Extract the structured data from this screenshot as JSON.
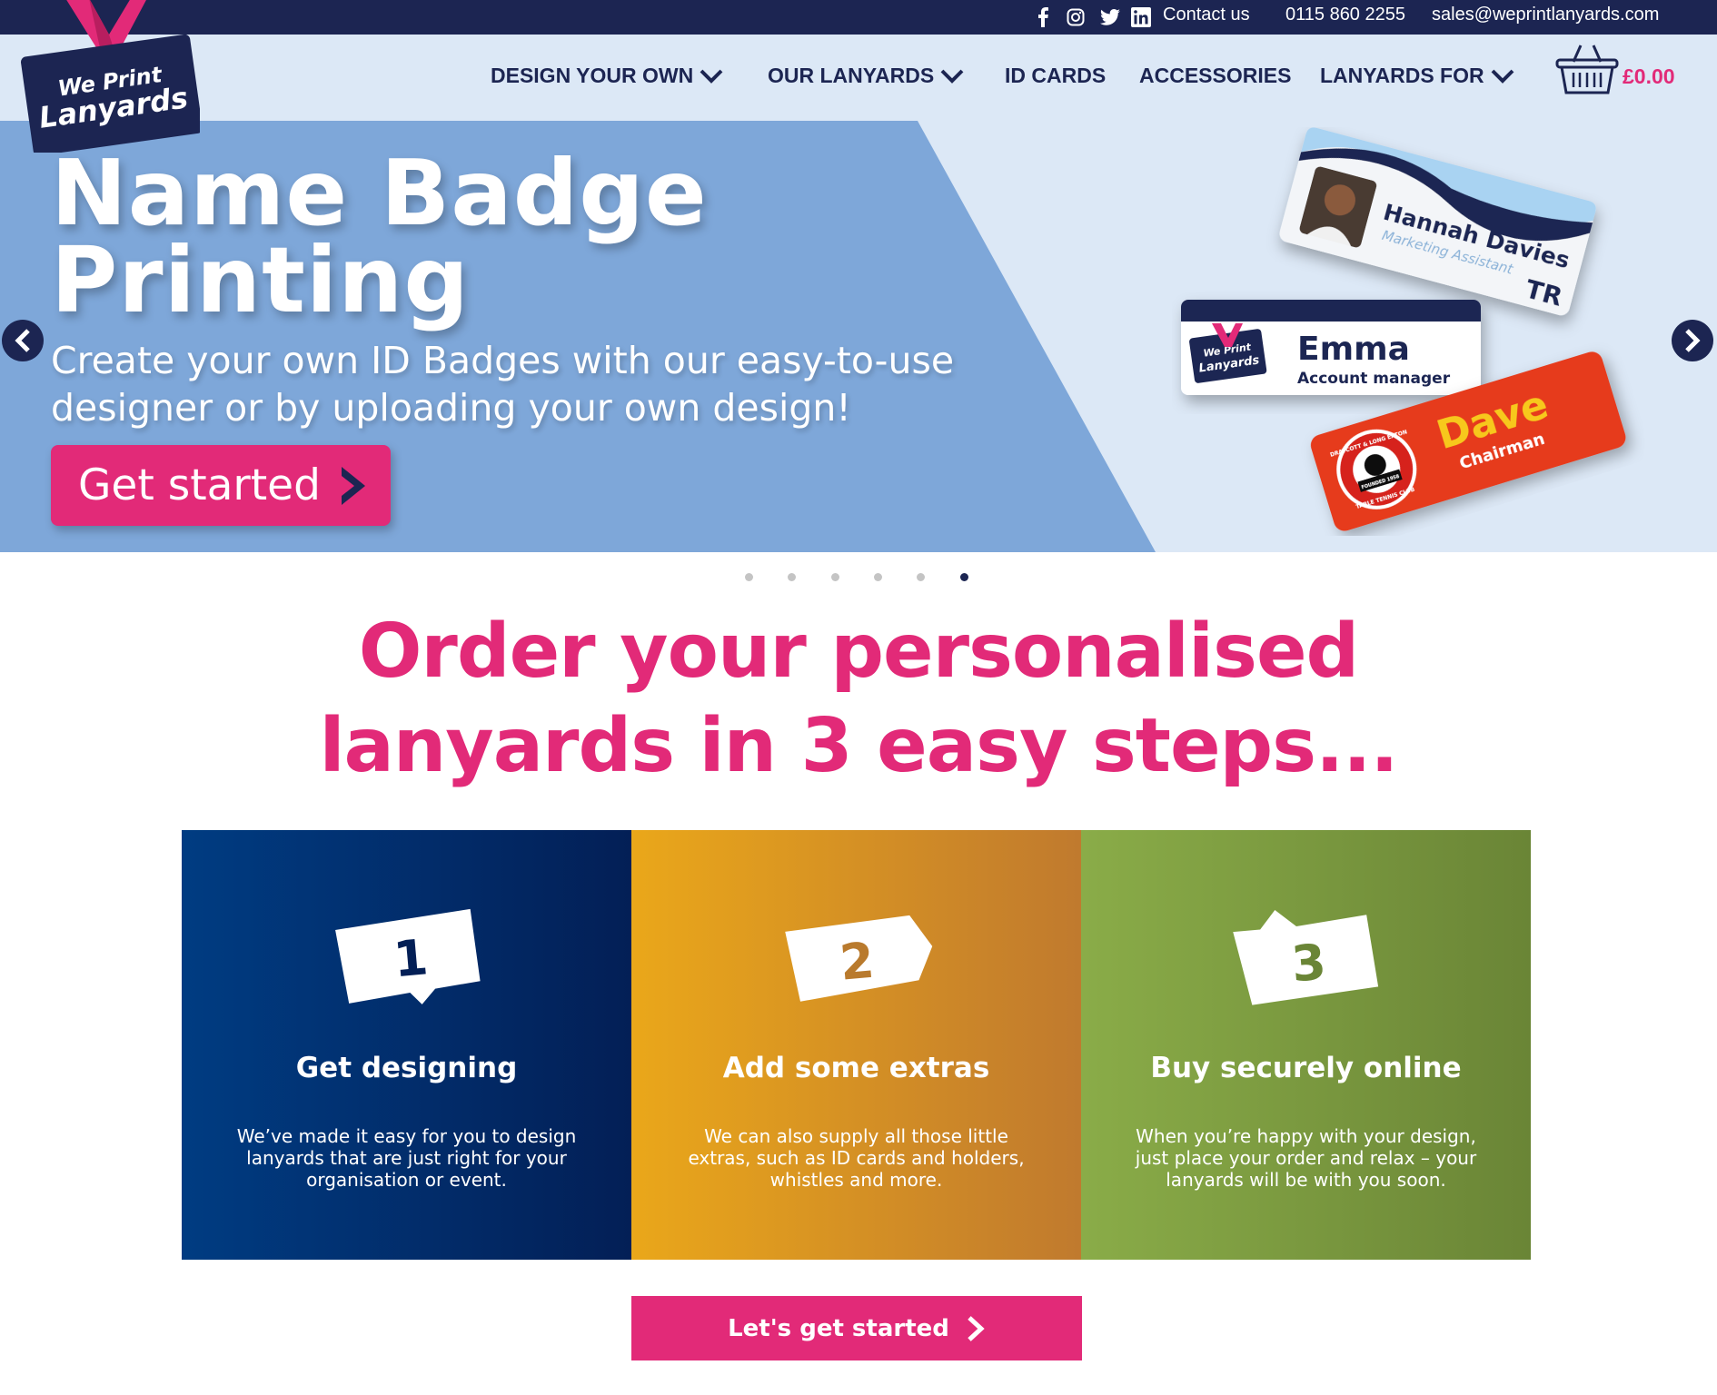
{
  "topbar": {
    "icons": [
      "facebook-icon",
      "instagram-icon",
      "twitter-icon",
      "linkedin-icon"
    ],
    "contact_label": "Contact us",
    "phone": "0115 860 2255",
    "email": "sales@weprintlanyards.com"
  },
  "brand": {
    "logo_line1": "We Print",
    "logo_line2": "Lanyards",
    "navy": "#1c2552",
    "pink": "#e22a78",
    "light_blue": "#dce8f6",
    "hero_blue": "#7ea7d9"
  },
  "nav": {
    "items": [
      {
        "label": "DESIGN YOUR OWN",
        "dropdown": true
      },
      {
        "label": "OUR LANYARDS",
        "dropdown": true
      },
      {
        "label": "ID CARDS",
        "dropdown": false
      },
      {
        "label": "ACCESSORIES",
        "dropdown": false
      },
      {
        "label": "LANYARDS FOR",
        "dropdown": true
      }
    ],
    "cart_total": "£0.00",
    "cart_icon": "basket-icon"
  },
  "hero": {
    "title_line1": "Name Badge",
    "title_line2": "Printing",
    "subtitle": "Create your own ID Badges with our easy-to-use designer or by uploading your own design!",
    "button_label": "Get started",
    "prev_icon": "chevron-left-icon",
    "next_icon": "chevron-right-icon",
    "cards": {
      "card1_name": "Hannah Davies",
      "card1_role": "Marketing Assistant",
      "card2_name": "Emma",
      "card2_role": "Account manager",
      "card2_logo_line1": "We Print",
      "card2_logo_line2": "Lanyards",
      "card3_name": "Dave",
      "card3_role": "Chairman",
      "card3_club_top": "DRAYCOTT & LONG EATON",
      "card3_club_founded": "FOUNDED 1958",
      "card3_club_bottom": "TABLE TENNIS CLUB"
    }
  },
  "carousel": {
    "total_dots": 6,
    "active_index": 5
  },
  "steps_section": {
    "heading_line1": "Order your personalised",
    "heading_line2": "lanyards in 3 easy steps...",
    "steps": [
      {
        "number": "1",
        "title": "Get designing",
        "text": "We’ve made it easy for you to design lanyards that are just right for your organisation or event.",
        "color_start": "#003c82",
        "color_end": "#031f56"
      },
      {
        "number": "2",
        "title": "Add some extras",
        "text": "We can also supply all those little extras, such as ID cards and holders, whistles and more.",
        "color_start": "#eaa71a",
        "color_end": "#c07a2e"
      },
      {
        "number": "3",
        "title": "Buy securely online",
        "text": "When you’re happy with your design, just place your order and relax – your lanyards will be with you soon.",
        "color_start": "#8aac48",
        "color_end": "#6a8536"
      }
    ],
    "cta_label": "Let's get started"
  }
}
